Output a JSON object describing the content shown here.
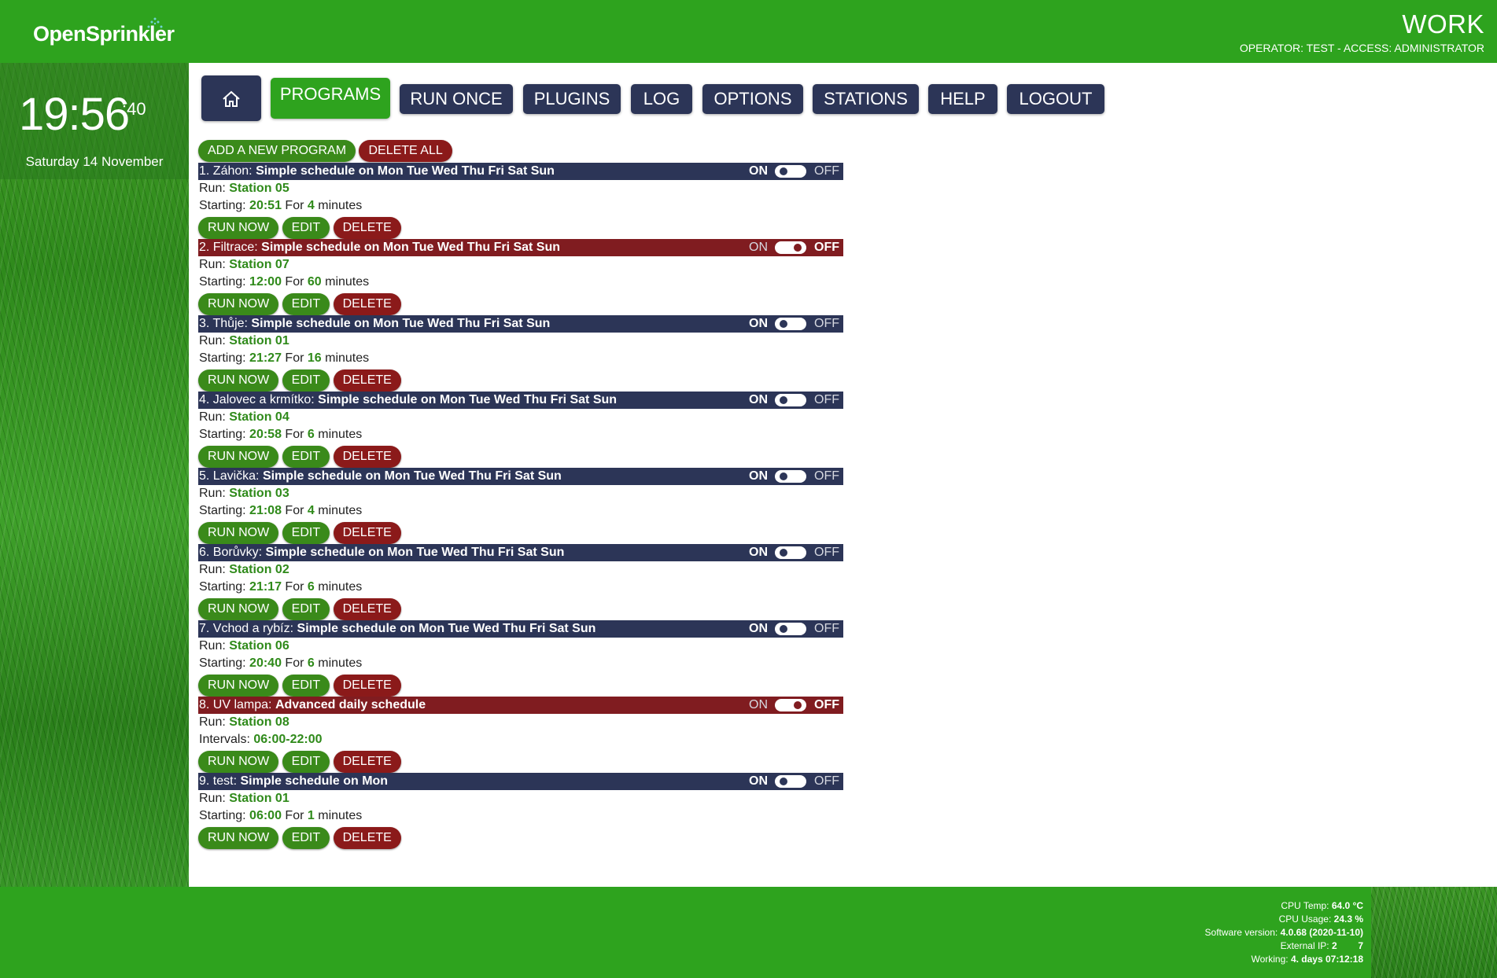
{
  "header": {
    "logo_text": "OpenSprinkler",
    "site_name": "WORK",
    "operator_line": "OPERATOR: TEST - ACCESS: ADMINISTRATOR"
  },
  "clock": {
    "time": "19:56",
    "seconds": ":40",
    "date": "Saturday 14 November"
  },
  "nav": {
    "home_icon": "home-icon",
    "items": [
      {
        "label": "PROGRAMS",
        "active": true
      },
      {
        "label": "RUN ONCE"
      },
      {
        "label": "PLUGINS"
      },
      {
        "label": "LOG"
      },
      {
        "label": "OPTIONS"
      },
      {
        "label": "STATIONS"
      },
      {
        "label": "HELP"
      },
      {
        "label": "LOGOUT"
      }
    ]
  },
  "actions": {
    "add_program": "ADD A NEW PROGRAM",
    "delete_all": "DELETE ALL"
  },
  "labels": {
    "run": "Run:",
    "starting": "Starting:",
    "for": "For",
    "minutes": "minutes",
    "intervals": "Intervals:",
    "on": "ON",
    "off": "OFF",
    "run_now": "RUN NOW",
    "edit": "EDIT",
    "delete": "DELETE"
  },
  "programs": [
    {
      "name": "1. Záhon:",
      "schedule": "Simple schedule on Mon Tue Wed Thu Fri Sat Sun",
      "enabled": true,
      "station": "Station 05",
      "start": "20:51",
      "duration": "4"
    },
    {
      "name": "2. Filtrace:",
      "schedule": "Simple schedule on Mon Tue Wed Thu Fri Sat Sun",
      "enabled": false,
      "station": "Station 07",
      "start": "12:00",
      "duration": "60"
    },
    {
      "name": "3. Thůje:",
      "schedule": "Simple schedule on Mon Tue Wed Thu Fri Sat Sun",
      "enabled": true,
      "station": "Station 01",
      "start": "21:27",
      "duration": "16"
    },
    {
      "name": "4. Jalovec a krmítko:",
      "schedule": "Simple schedule on Mon Tue Wed Thu Fri Sat Sun",
      "enabled": true,
      "station": "Station 04",
      "start": "20:58",
      "duration": "6"
    },
    {
      "name": "5. Lavička:",
      "schedule": "Simple schedule on Mon Tue Wed Thu Fri Sat Sun",
      "enabled": true,
      "station": "Station 03",
      "start": "21:08",
      "duration": "4"
    },
    {
      "name": "6. Borůvky:",
      "schedule": "Simple schedule on Mon Tue Wed Thu Fri Sat Sun",
      "enabled": true,
      "station": "Station 02",
      "start": "21:17",
      "duration": "6"
    },
    {
      "name": "7. Vchod a rybíz:",
      "schedule": "Simple schedule on Mon Tue Wed Thu Fri Sat Sun",
      "enabled": true,
      "station": "Station 06",
      "start": "20:40",
      "duration": "6"
    },
    {
      "name": "8. UV lampa:",
      "schedule": "Advanced daily schedule",
      "enabled": false,
      "station": "Station 08",
      "intervals": "06:00-22:00"
    },
    {
      "name": "9. test:",
      "schedule": "Simple schedule on Mon",
      "enabled": true,
      "station": "Station 01",
      "start": "06:00",
      "duration": "1"
    }
  ],
  "footer": {
    "cpu_temp_label": "CPU Temp:",
    "cpu_temp": "64.0 °C",
    "cpu_usage_label": "CPU Usage:",
    "cpu_usage": "24.3 %",
    "software_label": "Software version:",
    "software": "4.0.68 (2020-11-10)",
    "external_ip_label": "External IP:",
    "external_ip": "2        7",
    "working_label": "Working:",
    "working": "4. days 07:12:18"
  },
  "colors": {
    "brand_green": "#2ea31e",
    "navy": "#2c3557",
    "disabled_red": "#801c20",
    "value_green": "#2f8a1a"
  }
}
